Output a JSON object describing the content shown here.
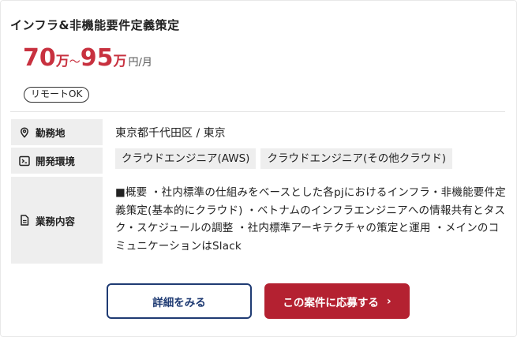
{
  "job": {
    "title": "インフラ&非機能要件定義策定",
    "price": {
      "min": "70",
      "max": "95",
      "unit": "万",
      "tilde": "〜",
      "per": "円/月"
    },
    "remote_badge": "リモートOK",
    "fields": {
      "location_label": "勤務地",
      "location_value": "東京都千代田区 / 東京",
      "env_label": "開発環境",
      "env_chips": [
        "クラウドエンジニア(AWS)",
        "クラウドエンジニア(その他クラウド)"
      ],
      "work_label": "業務内容",
      "work_value": "■概要 ・社内標準の仕組みをベースとした各pjにおけるインフラ・非機能要件定義策定(基本的にクラウド) ・ベトナムのインフラエンジニアへの情報共有とタスク・スケジュールの調整 ・社内標準アーキテクチャの策定と運用 ・メインのコミュニケーションはSlack"
    },
    "buttons": {
      "detail": "詳細をみる",
      "apply": "この案件に応募する",
      "apply_chevron": "›"
    }
  },
  "icons": {
    "location": "map-pin-icon",
    "env": "terminal-icon",
    "work": "document-icon"
  },
  "colors": {
    "price": "#c8313f",
    "apply_button": "#b42131",
    "detail_border": "#1f3b73",
    "label_bg": "#eeeeee"
  }
}
